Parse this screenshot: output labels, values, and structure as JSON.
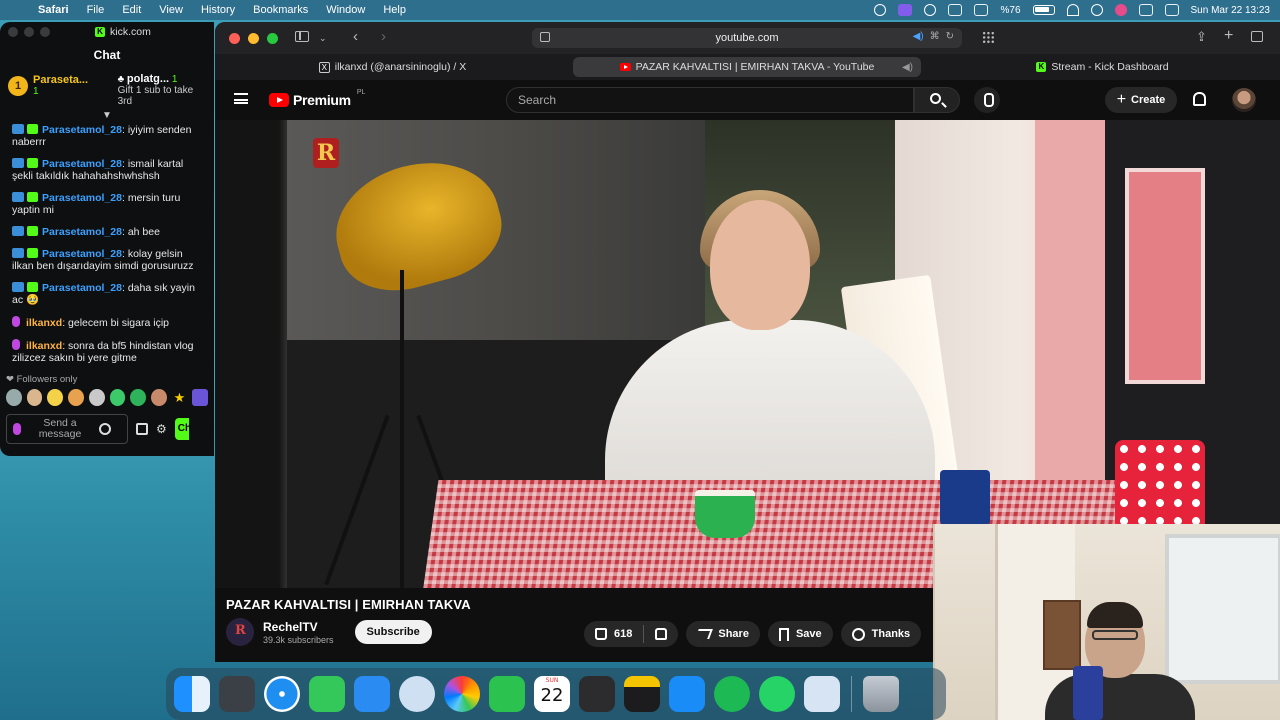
{
  "menubar": {
    "app_name": "Safari",
    "menus": [
      "File",
      "Edit",
      "View",
      "History",
      "Bookmarks",
      "Window",
      "Help"
    ],
    "battery": "%76",
    "datetime": "Sun Mar 22  13:23"
  },
  "kick": {
    "url": "kick.com",
    "chat_title": "Chat",
    "leaderboard": [
      {
        "rank": "1",
        "name": "Paraseta...",
        "count": "1"
      },
      {
        "name": "polatg...",
        "count": "1",
        "gift_text": "Gift 1 sub to take 3rd"
      }
    ],
    "messages": [
      {
        "user": "Parasetamol_28",
        "text": ": iyiyim senden naberrr",
        "type": "sub"
      },
      {
        "user": "Parasetamol_28",
        "text": ": ismail kartal şekli takıldık hahahahshwhshsh",
        "type": "sub"
      },
      {
        "user": "Parasetamol_28",
        "text": ": mersin turu yaptin mi",
        "type": "sub"
      },
      {
        "user": "Parasetamol_28",
        "text": ": ah bee",
        "type": "sub"
      },
      {
        "user": "Parasetamol_28",
        "text": ": kolay gelsin ilkan ben dışarıdayim simdi gorusuruzz",
        "type": "sub"
      },
      {
        "user": "Parasetamol_28",
        "text": ": daha sık yayin ac 🥹",
        "type": "sub"
      },
      {
        "user": "ilkanxd",
        "text": ": gelecem bi sigara içip",
        "type": "host"
      },
      {
        "user": "ilkanxd",
        "text": ": sonra da bf5 hindistan vlog zilizcez sakın bi yere gitme",
        "type": "host"
      }
    ],
    "followers_only": "❤ Followers only",
    "send_placeholder": "Send a message",
    "chat_button": "Ch"
  },
  "safari": {
    "address": "youtube.com",
    "tabs": [
      {
        "label": "ilkanxd (@anarsininoglu) / X",
        "icon": "x-icon"
      },
      {
        "label": "PAZAR KAHVALTISI | EMIRHAN TAKVA - YouTube",
        "icon": "youtube-icon",
        "active": true
      },
      {
        "label": "Stream - Kick Dashboard",
        "icon": "kick-icon"
      }
    ]
  },
  "youtube": {
    "logo_text": "Premium",
    "logo_region": "PL",
    "search_placeholder": "Search",
    "create_label": "Create",
    "video_title": "PAZAR KAHVALTISI | EMIRHAN TAKVA",
    "channel_name": "RechelTV",
    "channel_subs": "39.3k subscribers",
    "subscribe_label": "Subscribe",
    "likes": "618",
    "share_label": "Share",
    "save_label": "Save",
    "thanks_label": "Thanks"
  },
  "dock": {
    "calendar_day": "22",
    "apps": [
      "finder",
      "launchpad",
      "safari",
      "messages",
      "mail",
      "maps-instruments",
      "photos",
      "facetime",
      "calendar",
      "reminders",
      "notes",
      "app-store",
      "spotify",
      "whatsapp",
      "preview",
      "trash"
    ]
  },
  "colors": {
    "kick_green": "#53fc18",
    "youtube_red": "#ff0000",
    "chat_user_blue": "#3aa1ff",
    "chat_host_orange": "#ffb347"
  }
}
